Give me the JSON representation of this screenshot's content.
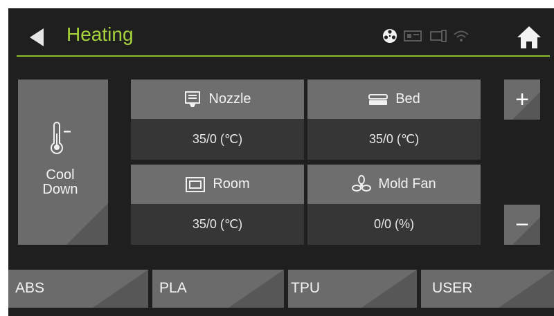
{
  "header": {
    "title": "Heating",
    "icons": [
      "back-arrow-icon",
      "film-reel-icon",
      "card-reader-icon",
      "usb-icon",
      "wifi-icon",
      "home-icon"
    ]
  },
  "cool_down": {
    "label": "Cool\nDown",
    "icon": "thermometer-minus-icon"
  },
  "sensors": [
    {
      "name": "Nozzle",
      "value": "35/0 (℃)",
      "icon": "nozzle-icon"
    },
    {
      "name": "Bed",
      "value": "35/0 (℃)",
      "icon": "bed-icon"
    },
    {
      "name": "Room",
      "value": "35/0 (℃)",
      "icon": "room-icon"
    },
    {
      "name": "Mold Fan",
      "value": "0/0 (%)",
      "icon": "fan-icon"
    }
  ],
  "stepper": {
    "plus": "+",
    "minus": "−"
  },
  "materials": [
    "ABS",
    "PLA",
    "TPU",
    "USER"
  ],
  "colors": {
    "title": "#a6d43a",
    "background": "#1f1f1f",
    "button": "#6b6b6b",
    "value_bg": "#363636"
  }
}
